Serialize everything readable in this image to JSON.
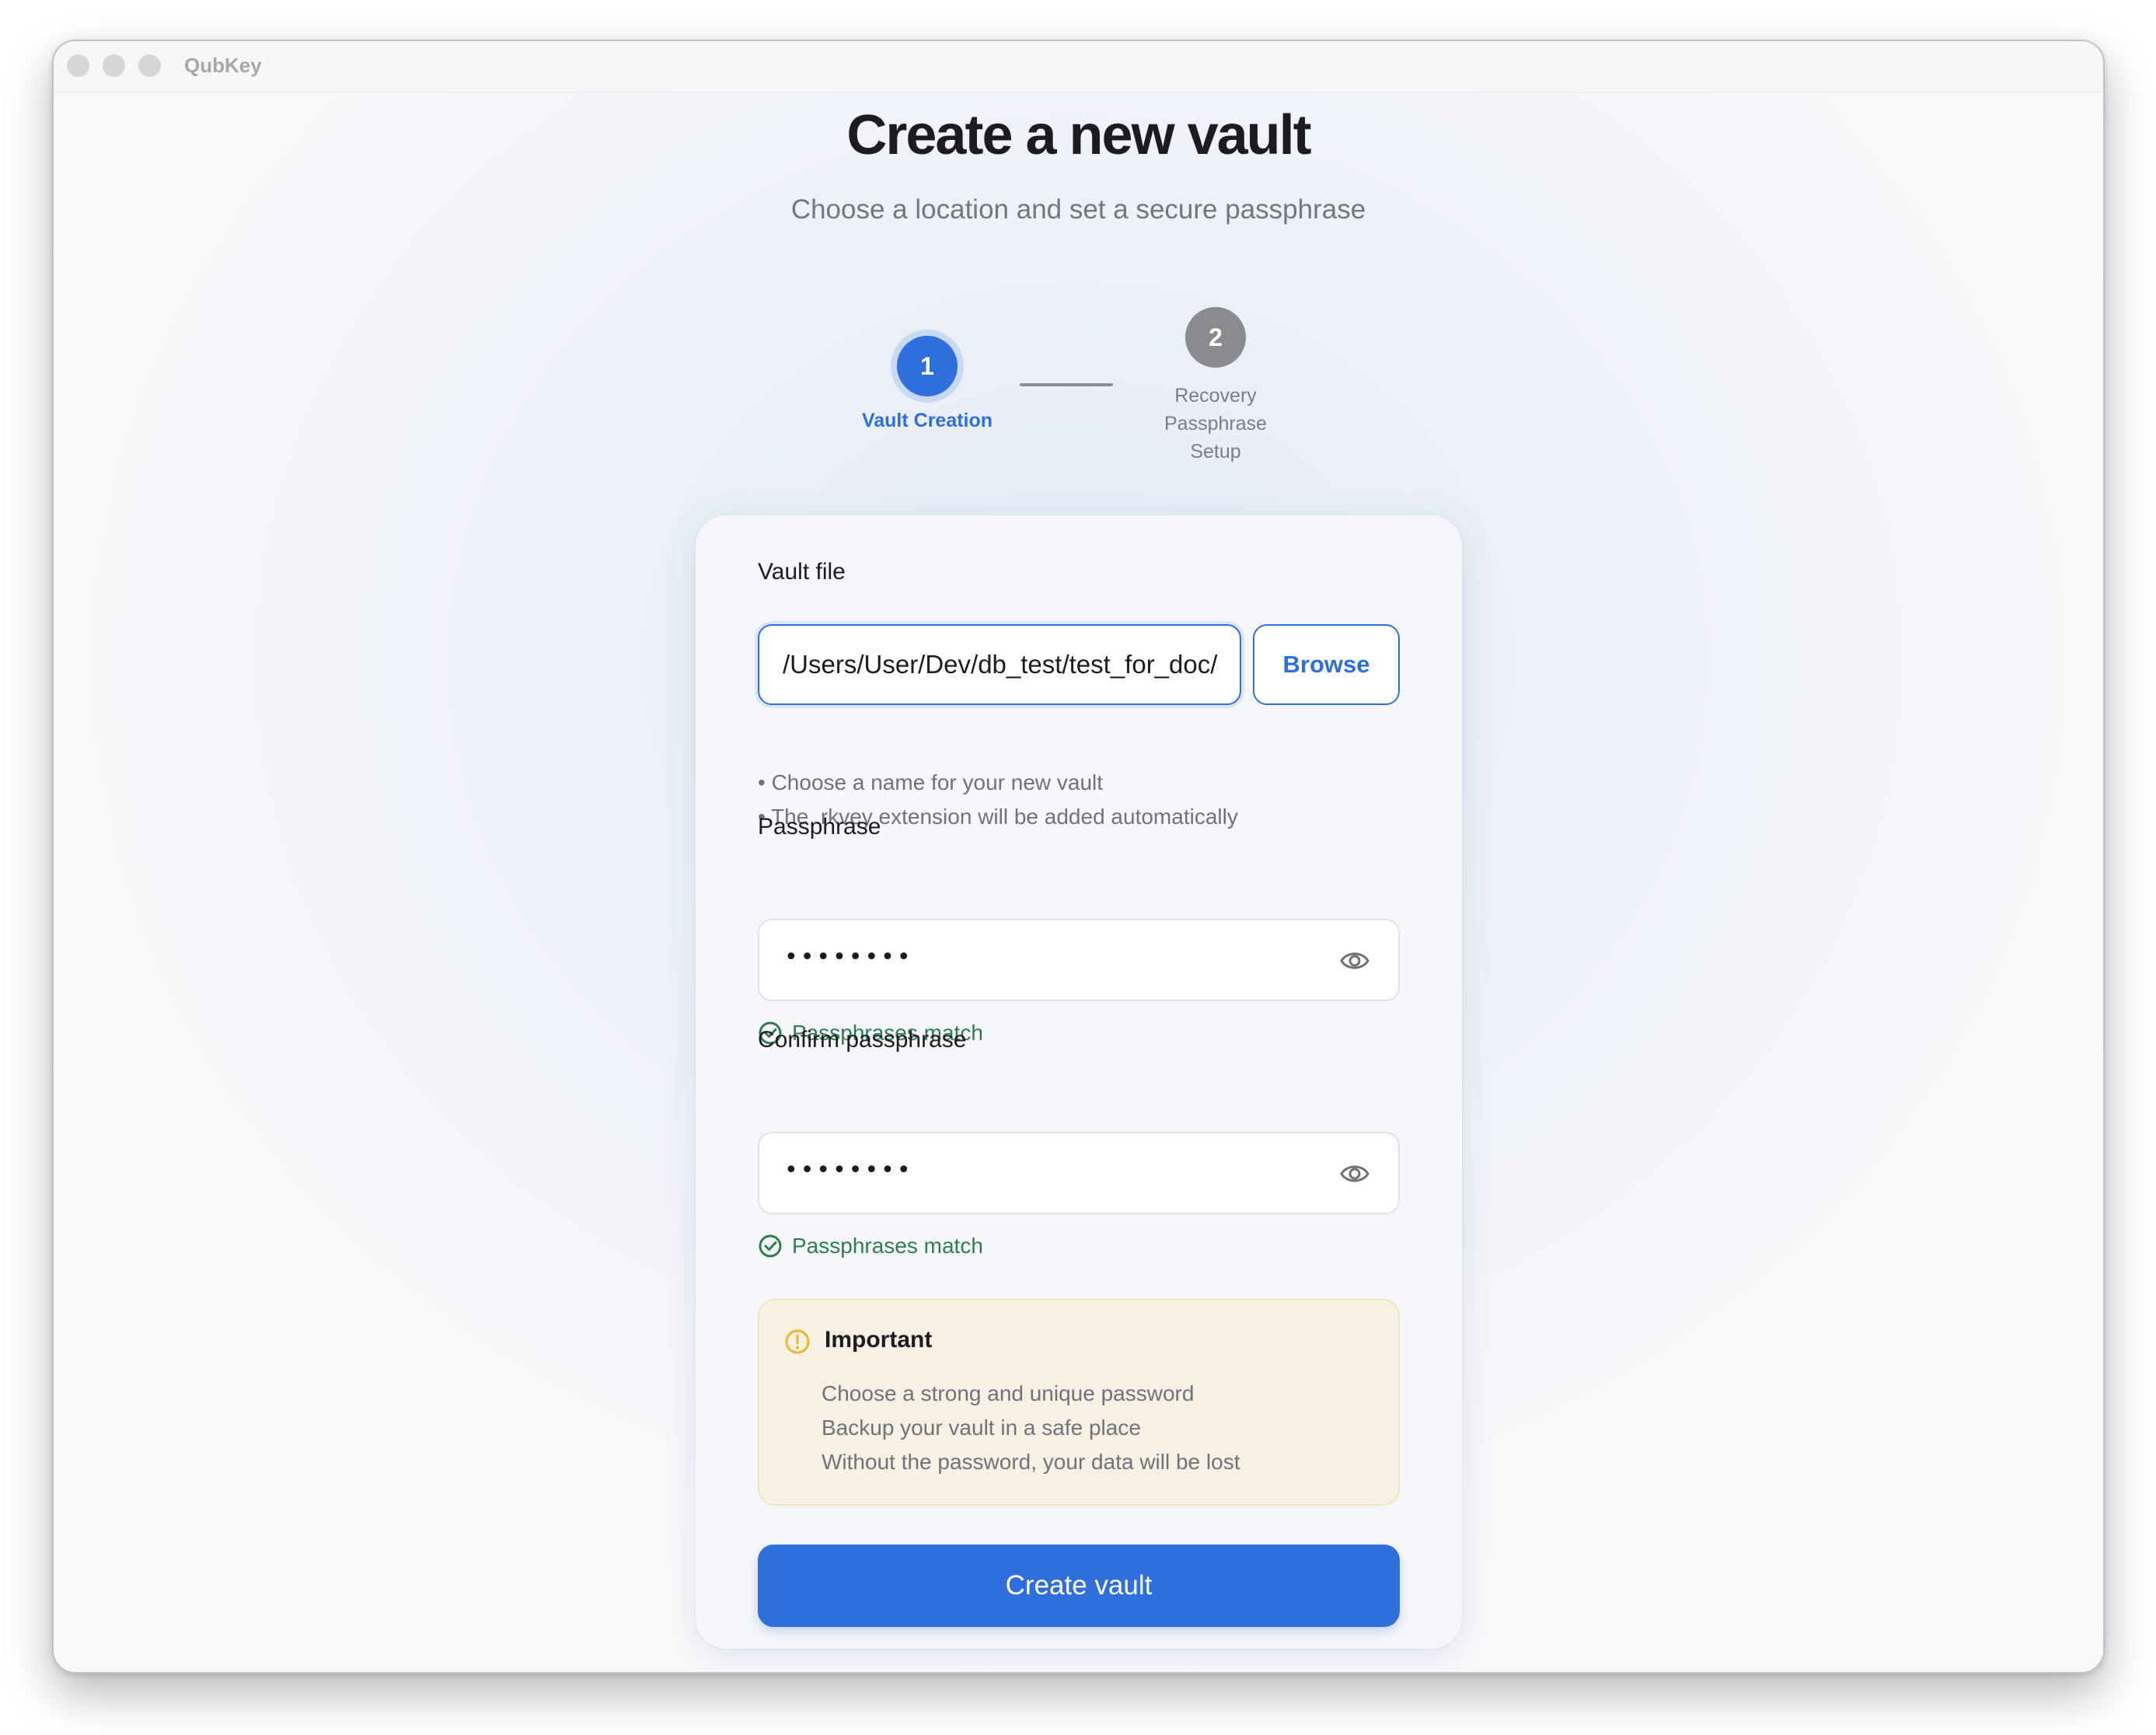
{
  "window": {
    "app_title": "QubKey"
  },
  "header": {
    "title": "Create a new vault",
    "subtitle": "Choose a location and set a secure passphrase"
  },
  "stepper": {
    "steps": [
      {
        "number": "1",
        "label": "Vault Creation",
        "state": "active"
      },
      {
        "number": "2",
        "label_lines": [
          "Recovery",
          "Passphrase",
          "Setup"
        ],
        "state": "inactive"
      }
    ]
  },
  "form": {
    "vault_file": {
      "label": "Vault file",
      "value": "/Users/User/Dev/db_test/test_for_doc/",
      "browse_label": "Browse",
      "hints": [
        "• Choose a name for your new vault",
        "• The .rkvey extension will be added automatically"
      ]
    },
    "passphrase": {
      "label": "Passphrase",
      "masked_value": "••••••••",
      "status": "Passphrases match",
      "icon": "eye-icon"
    },
    "confirm_passphrase": {
      "label": "Confirm passphrase",
      "masked_value": "••••••••",
      "status": "Passphrases match",
      "icon": "eye-icon"
    },
    "important": {
      "title": "Important",
      "lines": [
        "Choose a strong and unique password",
        "Backup your vault in a safe place",
        "Without the password, your data will be lost"
      ],
      "icon": "warning-icon"
    },
    "submit_label": "Create vault"
  },
  "colors": {
    "accent": "#2f6fdc",
    "success": "#2e7d4f",
    "warning": "#f0b429",
    "warning_bg": "#f7f1e4"
  }
}
